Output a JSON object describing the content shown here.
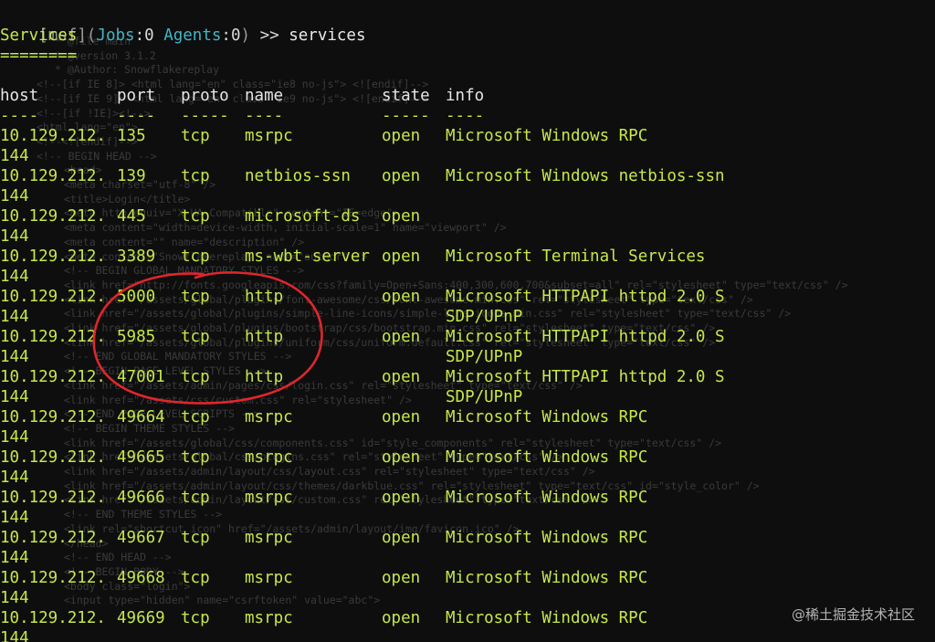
{
  "prompt": {
    "open_bracket": "[",
    "msf": "msf",
    "close_bracket": "]",
    "open_paren": "(",
    "jobs_label": "Jobs",
    "jobs_sep": ":",
    "jobs_value": "0",
    "space": " ",
    "agents_label": "Agents",
    "agents_sep": ":",
    "agents_value": "0",
    "close_paren": ")",
    "arrow": " >> ",
    "command": "services"
  },
  "heading": {
    "title": "Services",
    "underline": "========"
  },
  "table": {
    "headers": {
      "host": "host",
      "port": "port",
      "proto": "proto",
      "name": "name",
      "state": "state",
      "info": "info"
    },
    "separators": {
      "host": "----",
      "port": "----",
      "proto": "-----",
      "name": "----",
      "state": "-----",
      "info": "----"
    },
    "rows": [
      {
        "host": "10.129.212.",
        "host2": "144",
        "port": "135",
        "proto": "tcp",
        "name": "msrpc",
        "state": "open",
        "info": "Microsoft Windows RPC",
        "info2": ""
      },
      {
        "host": "10.129.212.",
        "host2": "144",
        "port": "139",
        "proto": "tcp",
        "name": "netbios-ssn",
        "state": "open",
        "info": "Microsoft Windows netbios-ssn",
        "info2": ""
      },
      {
        "host": "10.129.212.",
        "host2": "144",
        "port": "445",
        "proto": "tcp",
        "name": "microsoft-ds",
        "state": "open",
        "info": "",
        "info2": ""
      },
      {
        "host": "10.129.212.",
        "host2": "144",
        "port": "3389",
        "proto": "tcp",
        "name": "ms-wbt-server",
        "state": "open",
        "info": "Microsoft Terminal Services",
        "info2": ""
      },
      {
        "host": "10.129.212.",
        "host2": "144",
        "port": "5000",
        "proto": "tcp",
        "name": "http",
        "state": "open",
        "info": "Microsoft HTTPAPI httpd 2.0 S",
        "info2": "SDP/UPnP"
      },
      {
        "host": "10.129.212.",
        "host2": "144",
        "port": "5985",
        "proto": "tcp",
        "name": "http",
        "state": "open",
        "info": "Microsoft HTTPAPI httpd 2.0 S",
        "info2": "SDP/UPnP"
      },
      {
        "host": "10.129.212.",
        "host2": "144",
        "port": "47001",
        "proto": "tcp",
        "name": "http",
        "state": "open",
        "info": "Microsoft HTTPAPI httpd 2.0 S",
        "info2": "SDP/UPnP"
      },
      {
        "host": "10.129.212.",
        "host2": "144",
        "port": "49664",
        "proto": "tcp",
        "name": "msrpc",
        "state": "open",
        "info": "Microsoft Windows RPC",
        "info2": ""
      },
      {
        "host": "10.129.212.",
        "host2": "144",
        "port": "49665",
        "proto": "tcp",
        "name": "msrpc",
        "state": "open",
        "info": "Microsoft Windows RPC",
        "info2": ""
      },
      {
        "host": "10.129.212.",
        "host2": "144",
        "port": "49666",
        "proto": "tcp",
        "name": "msrpc",
        "state": "open",
        "info": "Microsoft Windows RPC",
        "info2": ""
      },
      {
        "host": "10.129.212.",
        "host2": "144",
        "port": "49667",
        "proto": "tcp",
        "name": "msrpc",
        "state": "open",
        "info": "Microsoft Windows RPC",
        "info2": ""
      },
      {
        "host": "10.129.212.",
        "host2": "144",
        "port": "49668",
        "proto": "tcp",
        "name": "msrpc",
        "state": "open",
        "info": "Microsoft Windows RPC",
        "info2": ""
      },
      {
        "host": "10.129.212.",
        "host2": "144",
        "port": "49669",
        "proto": "tcp",
        "name": "msrpc",
        "state": "open",
        "info": "Microsoft Windows RPC",
        "info2": ""
      }
    ]
  },
  "background_ghost": [
    "* @file main",
    "* @version 3.1.2",
    "* @Author: Snowflakereplay",
    "<!--[if IE 8]> <html lang=\"en\" class=\"ie8 no-js\"> <![endif]-->",
    "<!--[if IE 9]> <html lang=\"en\" class=\"ie9 no-js\"> <![endif]-->",
    "<!--[if !IE]><!-->",
    "<html lang=\"en\">",
    "<!--<![endif]-->",
    "<!-- BEGIN HEAD -->",
    "<head>",
    "<meta charset=\"utf-8\" />",
    "<title>Login</title>",
    "<meta http-equiv=\"X-UA-Compatible\" content=\"IE=edge\">",
    "<meta content=\"width=device-width, initial-scale=1\" name=\"viewport\" />",
    "<meta content=\"\" name=\"description\" />",
    "<meta content=\"Snowflakereplay\" name=\"author\" />",
    "<!-- BEGIN GLOBAL MANDATORY STYLES -->",
    "<link href=\"http://fonts.googleapis.com/css?family=Open+Sans:400,300,600,700&subset=all\" rel=\"stylesheet\" type=\"text/css\" />",
    "<link href=\"/assets/global/plugins/font-awesome/css/font-awesome.min.css\" rel=\"stylesheet\" type=\"text/css\" />",
    "<link href=\"/assets/global/plugins/simple-line-icons/simple-line-icons.min.css\" rel=\"stylesheet\" type=\"text/css\" />",
    "<link href=\"/assets/global/plugins/bootstrap/css/bootstrap.min.css\" rel=\"stylesheet\" type=\"text/css\" />",
    "<link href=\"/assets/global/plugins/uniform/css/uniform.default.css\" rel=\"stylesheet\" type=\"text/css\" />",
    "<!-- END GLOBAL MANDATORY STYLES -->",
    "<!-- BEGIN PAGE LEVEL STYLES -->",
    "<link href=\"/assets/admin/pages/css/login.css\" rel=\"stylesheet\" type=\"text/css\" />",
    "<link href=\"/assets/css/custom.css\" rel=\"stylesheet\" />",
    "<!-- END PAGE LEVEL SCRIPTS -->",
    "<!-- BEGIN THEME STYLES -->",
    "<link href=\"/assets/global/css/components.css\" id=\"style_components\" rel=\"stylesheet\" type=\"text/css\" />",
    "<link href=\"/assets/global/css/plugins.css\" rel=\"stylesheet\" type=\"text/css\" />",
    "<link href=\"/assets/admin/layout/css/layout.css\" rel=\"stylesheet\" type=\"text/css\" />",
    "<link href=\"/assets/admin/layout/css/themes/darkblue.css\" rel=\"stylesheet\" type=\"text/css\" id=\"style_color\" />",
    "<link href=\"/assets/admin/layout/css/custom.css\" rel=\"stylesheet\" type=\"text/css\" />",
    "<!-- END THEME STYLES -->",
    "<link rel=\"shortcut icon\" href=\"/assets/admin/layout/img/favicon.ico\" />",
    "</head>",
    "<!-- END HEAD -->",
    "<!-- BEGIN BODY -->",
    "<body class=\"login\">",
    "<input type=\"hidden\" name=\"csrftoken\" value=\"abc\">"
  ],
  "watermark": "@稀土掘金技术社区",
  "colors": {
    "background": "#0e0e0e",
    "text_green": "#c6e84a",
    "prompt_cyan": "#3fb7c4",
    "annotation_red": "#e0262b"
  }
}
